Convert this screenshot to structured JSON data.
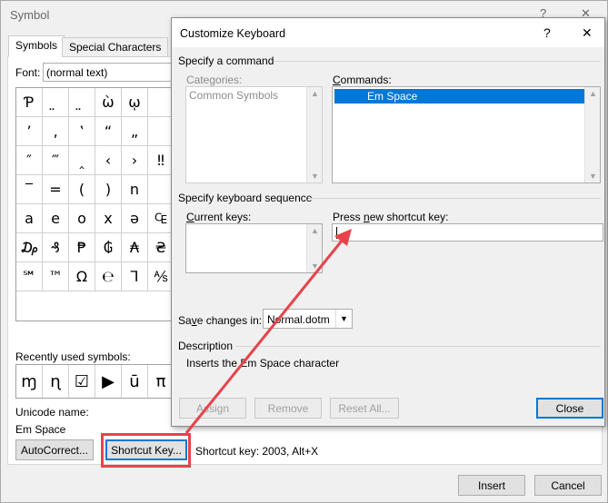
{
  "symbol_dialog": {
    "title": "Symbol",
    "help_glyph": "?",
    "close_glyph": "✕",
    "tabs": [
      "Symbols",
      "Special Characters"
    ],
    "font_label": "Font:",
    "font_value": "(normal text)",
    "symbol_grid": [
      "Ƥ",
      "̤",
      "̤",
      "ὼ",
      "ῳ",
      "",
      "’",
      "‚",
      "‛",
      "“",
      "„",
      "",
      "″",
      "‴",
      "‸",
      "‹",
      "›",
      "‼",
      "‾",
      "=",
      "(",
      ")",
      "n",
      "",
      "a",
      "e",
      "o",
      "x",
      "ə",
      "₠",
      "₯",
      "₰",
      "₱",
      "₲",
      "₳",
      "₴",
      "℠",
      "™",
      "Ω",
      "℮",
      "⅂",
      "⅍"
    ],
    "recently_used_label": "Recently used symbols:",
    "recent_symbols": [
      "ɱ",
      "ɳ",
      "☑",
      "▶",
      "ū",
      "π"
    ],
    "unicode_name_label": "Unicode name:",
    "unicode_name_value": "Em Space",
    "autocorrect_button": "AutoCorrect...",
    "shortcut_key_button": "Shortcut Key...",
    "shortcut_key_text": "Shortcut key: 2003, Alt+X",
    "insert_button": "Insert",
    "cancel_button": "Cancel"
  },
  "customize_keyboard": {
    "title": "Customize Keyboard",
    "help_glyph": "?",
    "close_glyph": "✕",
    "specify_command_label": "Specify a command",
    "categories_label": "Categories:",
    "categories_items": [
      "Common Symbols"
    ],
    "commands_label": "Commands:",
    "commands_items": [
      "Em Space"
    ],
    "specify_sequence_label": "Specify keyboard sequence",
    "current_keys_label": "Current keys:",
    "press_new_label": "Press new shortcut key:",
    "press_new_value": "",
    "save_changes_label": "Save changes in:",
    "save_changes_value": "Normal.dotm",
    "description_label": "Description",
    "description_text": "Inserts the Em Space character",
    "assign_button": "Assign",
    "remove_button": "Remove",
    "reset_all_button": "Reset All...",
    "close_button": "Close"
  },
  "colors": {
    "highlight": "#0078d7",
    "annotation": "#e8434b"
  }
}
